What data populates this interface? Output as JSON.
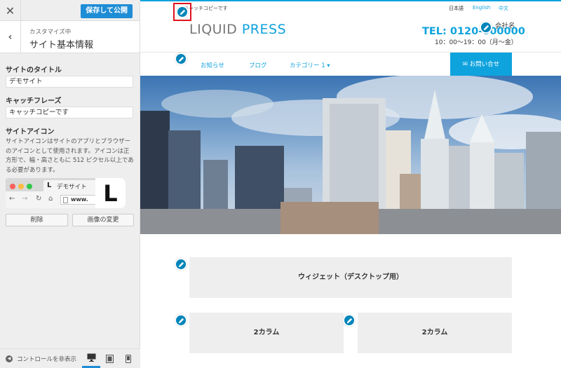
{
  "customizer": {
    "close_glyph": "✕",
    "publish_label": "保存して公開",
    "back_glyph": "‹",
    "breadcrumb": "カスタマイズ中",
    "section_title": "サイト基本情報",
    "site_title_label": "サイトのタイトル",
    "site_title_value": "デモサイト",
    "tagline_label": "キャッチフレーズ",
    "tagline_value": "キャッチコピーです",
    "site_icon_label": "サイトアイコン",
    "site_icon_description": "サイトアイコンはサイトのアプリとブラウザーのアイコンとして使用されます。アイコンは正方形で、幅・高さともに 512 ピクセル以上である必要があります。",
    "browser_preview": {
      "tab_logo": "L",
      "tab_title": "デモサイト",
      "url_text": "www.",
      "large_icon": "L"
    },
    "remove_button": "削除",
    "change_image_button": "画像の変更",
    "collapse_label": "コントロールを非表示",
    "accent_color": "#1f8dd6"
  },
  "site": {
    "tagline": "キャッチコピーです",
    "languages": [
      "日本語",
      "English",
      "中文"
    ],
    "logo_part1": "LIQUID",
    "logo_part2": "PRESS",
    "company": "会社名",
    "tel": "TEL: 0120-000000",
    "hours": "10：00〜19：00（月〜金）",
    "nav": [
      "お知らせ",
      "ブログ",
      "カテゴリー 1 ▾"
    ],
    "contact_button": "お問い合せ",
    "widget_main": "ウィジェット（デスクトップ用）",
    "widget_col1": "2カラム",
    "widget_col2": "2カラム",
    "brand_color": "#0fa3de",
    "edit_icon_color": "#0085ba"
  }
}
